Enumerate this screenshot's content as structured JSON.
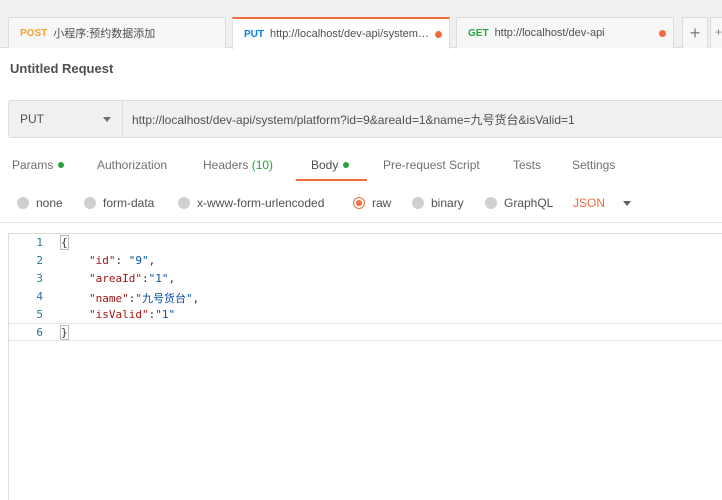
{
  "tabs": [
    {
      "method": "POST",
      "method_color": "#f4a22c",
      "label": "小程序:预约数据添加",
      "active": false,
      "dirty": false
    },
    {
      "method": "PUT",
      "method_color": "#097bed",
      "label": "http://localhost/dev-api/system…",
      "active": true,
      "dirty": true
    },
    {
      "method": "GET",
      "method_color": "#26a541",
      "label": "http://localhost/dev-api",
      "active": false,
      "dirty": true
    }
  ],
  "tab_add_label": "+",
  "tab_more_label": "+",
  "request_title": "Untitled Request",
  "method": "PUT",
  "url": "http://localhost/dev-api/system/platform?id=9&areaId=1&name=九号货台&isValid=1",
  "request_tabs": {
    "params": "Params",
    "authorization": "Authorization",
    "headers": "Headers",
    "headers_count": "(10)",
    "body": "Body",
    "pre_request": "Pre-request Script",
    "tests": "Tests",
    "settings": "Settings"
  },
  "body_types": {
    "none": "none",
    "form_data": "form-data",
    "urlencoded": "x-www-form-urlencoded",
    "raw": "raw",
    "binary": "binary",
    "graphql": "GraphQL",
    "selected": "raw"
  },
  "raw_format": "JSON",
  "editor": {
    "line_numbers": [
      "1",
      "2",
      "3",
      "4",
      "5",
      "6"
    ],
    "open_brace": "{",
    "close_brace": "}",
    "fields": [
      {
        "key": "\"id\"",
        "sep": ": ",
        "value": "\"9\"",
        "end": ","
      },
      {
        "key": "\"areaId\"",
        "sep": ":",
        "value": "\"1\"",
        "end": ","
      },
      {
        "key": "\"name\"",
        "sep": ":",
        "value": "\"九号货台\"",
        "end": ","
      },
      {
        "key": "\"isValid\"",
        "sep": ":",
        "value": "\"1\"",
        "end": ""
      }
    ]
  },
  "colors": {
    "accent": "#f26b3a",
    "green": "#26a541"
  }
}
